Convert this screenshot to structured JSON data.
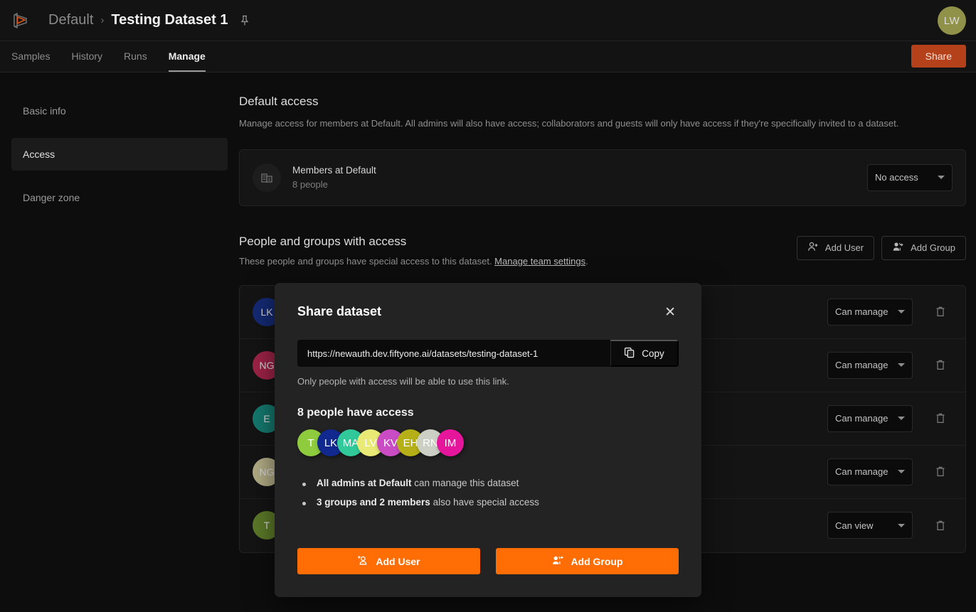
{
  "header": {
    "logo_icon": "fiftyone-logo-icon",
    "org": "Default",
    "separator": "›",
    "dataset_title": "Testing Dataset 1",
    "pin_icon": "pin-icon",
    "avatar_initials": "LW",
    "avatar_color": "#8f9248"
  },
  "tabs": [
    {
      "label": "Samples",
      "active": false
    },
    {
      "label": "History",
      "active": false
    },
    {
      "label": "Runs",
      "active": false
    },
    {
      "label": "Manage",
      "active": true
    }
  ],
  "share_button": {
    "label": "Share",
    "color": "#b4411a"
  },
  "sidebar": {
    "items": [
      {
        "label": "Basic info",
        "active": false
      },
      {
        "label": "Access",
        "active": true
      },
      {
        "label": "Danger zone",
        "active": false
      }
    ]
  },
  "default_access": {
    "title": "Default access",
    "description": "Manage access for members at Default. All admins will also have access; collaborators and guests will only have access if they're specifically invited to a dataset.",
    "card": {
      "icon": "building-icon",
      "name": "Members at Default",
      "subtitle": "8 people",
      "permission": "No access"
    }
  },
  "people_section": {
    "title": "People and groups with access",
    "description_prefix": "These people and groups have special access to this dataset. ",
    "description_link": "Manage team settings",
    "description_suffix": ".",
    "add_user_label": "Add User",
    "add_group_label": "Add Group",
    "rows": [
      {
        "initials": "LK",
        "color": "#142a73",
        "permission": "Can manage"
      },
      {
        "initials": "NG",
        "color": "#9e2347",
        "permission": "Can manage"
      },
      {
        "initials": "E",
        "color": "#14796e",
        "permission": "Can manage"
      },
      {
        "initials": "NG",
        "color": "#b2ac85",
        "permission": "Can manage"
      },
      {
        "initials": "T",
        "color": "#5c7a28",
        "permission": "Can view"
      }
    ],
    "delete_icon": "trash-icon",
    "dropdown_icon": "chevron-down-icon"
  },
  "modal": {
    "title": "Share dataset",
    "close_icon": "close-icon",
    "url": "https://newauth.dev.fiftyone.ai/datasets/testing-dataset-1",
    "copy_label": "Copy",
    "copy_icon": "copy-icon",
    "url_note": "Only people with access will be able to use this link.",
    "access_count_label": "8 people have access",
    "avatars": [
      {
        "initials": "T",
        "color": "#8ecc3e"
      },
      {
        "initials": "LK",
        "color": "#11288f"
      },
      {
        "initials": "MA",
        "color": "#31c99a"
      },
      {
        "initials": "LV",
        "color": "#e8ea75"
      },
      {
        "initials": "KV",
        "color": "#c94cc4"
      },
      {
        "initials": "EH",
        "color": "#b5b018"
      },
      {
        "initials": "RN",
        "color": "#ccd0c4"
      },
      {
        "initials": "IM",
        "color": "#e5169b"
      }
    ],
    "bullets": [
      {
        "strong": "All admins at Default",
        "rest": " can manage this dataset"
      },
      {
        "strong": "3 groups and 2 members",
        "rest": " also have special access"
      }
    ],
    "add_user_label": "Add User",
    "add_group_label": "Add Group",
    "primary_color": "#ff6d04"
  }
}
